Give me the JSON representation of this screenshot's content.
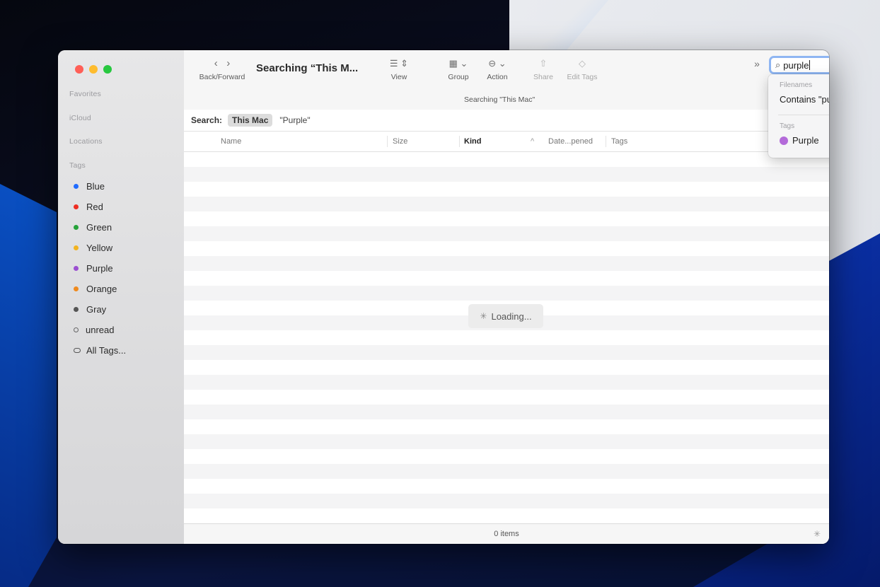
{
  "sidebar": {
    "sections": [
      "Favorites",
      "iCloud",
      "Locations",
      "Tags"
    ],
    "tags": [
      {
        "label": "Blue",
        "color": "#1f6bff",
        "icon": "blue-tag-dot"
      },
      {
        "label": "Red",
        "color": "#ee2e22",
        "icon": "red-tag-dot"
      },
      {
        "label": "Green",
        "color": "#26a33a",
        "icon": "green-tag-dot"
      },
      {
        "label": "Yellow",
        "color": "#f2b321",
        "icon": "yellow-tag-dot"
      },
      {
        "label": "Purple",
        "color": "#9b4fd1",
        "icon": "purple-tag-dot"
      },
      {
        "label": "Orange",
        "color": "#ef8a1e",
        "icon": "orange-tag-dot"
      },
      {
        "label": "Gray",
        "color": "#555555",
        "icon": "gray-tag-dot"
      },
      {
        "label": "unread",
        "color": "",
        "icon": "hollow-circle-icon"
      },
      {
        "label": "All Tags...",
        "color": "",
        "icon": "all-tags-icon"
      }
    ]
  },
  "toolbar": {
    "back_forward_label": "Back/Forward",
    "window_title": "Searching “This M...",
    "view_label": "View",
    "group_label": "Group",
    "action_label": "Action",
    "share_label": "Share",
    "edit_tags_label": "Edit Tags",
    "subtitle": "Searching \"This Mac\""
  },
  "search": {
    "query": "purple",
    "scope_label": "Search:",
    "scope_selected": "This Mac",
    "scope_other": "\"Purple\""
  },
  "columns": {
    "name": "Name",
    "size": "Size",
    "kind": "Kind",
    "date": "Date...pened",
    "tags": "Tags"
  },
  "content": {
    "loading": "Loading..."
  },
  "status": {
    "items": "0 items"
  },
  "suggestions": {
    "filenames_header": "Filenames",
    "filenames_item": "Contains \"purple\"",
    "tags_header": "Tags",
    "tags_item": "Purple",
    "tags_item_color": "#b36ad9"
  }
}
